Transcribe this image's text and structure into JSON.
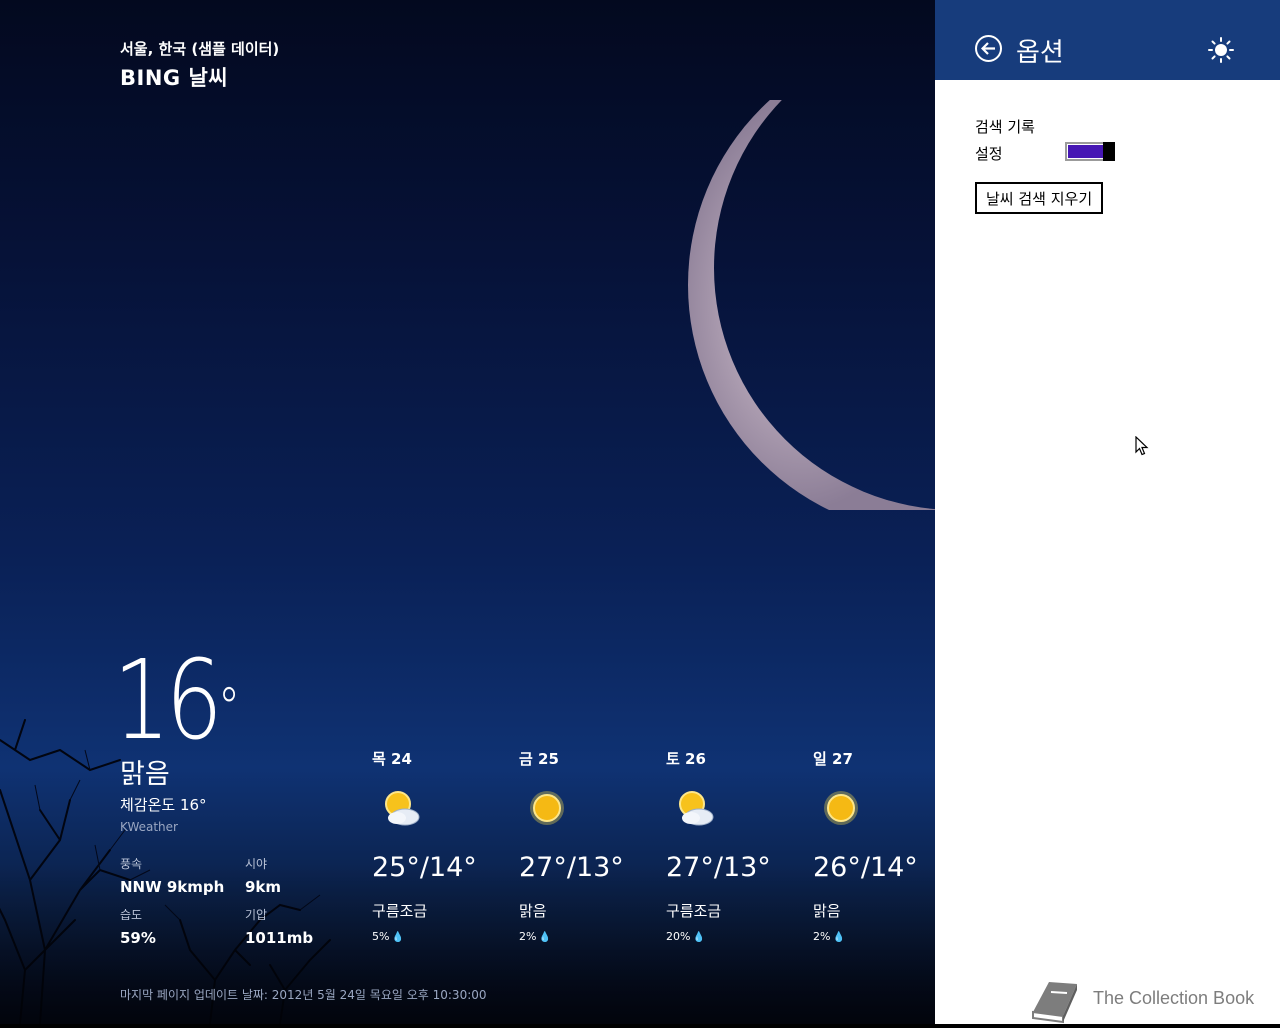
{
  "weather": {
    "location": "서울, 한국 (샘플 데이터)",
    "app_name": "BING 날씨",
    "current": {
      "temperature": "16",
      "degree_symbol": "°",
      "condition": "맑음",
      "feels_like": "체감온도 16°",
      "provider": "KWeather"
    },
    "details": {
      "wind_label": "풍속",
      "wind_value": "NNW 9kmph",
      "visibility_label": "시야",
      "visibility_value": "9km",
      "humidity_label": "습도",
      "humidity_value": "59%",
      "pressure_label": "기압",
      "pressure_value": "1011mb"
    },
    "forecast": [
      {
        "day": "목 24",
        "icon": "partly-cloudy-icon",
        "temp": "25°/14°",
        "condition": "구름조금",
        "precip": "5%"
      },
      {
        "day": "금 25",
        "icon": "sunny-icon",
        "temp": "27°/13°",
        "condition": "맑음",
        "precip": "2%"
      },
      {
        "day": "토 26",
        "icon": "partly-cloudy-icon",
        "temp": "27°/13°",
        "condition": "구름조금",
        "precip": "20%"
      },
      {
        "day": "일 27",
        "icon": "sunny-icon",
        "temp": "26°/14°",
        "condition": "맑음",
        "precip": "2%"
      }
    ],
    "last_updated": "마지막 페이지 업데이트 날짜: 2012년 5월 24일 목요일 오후 10:30:00"
  },
  "flyout": {
    "title": "옵션",
    "back_icon": "back-arrow-icon",
    "brightness_icon": "sun-icon",
    "section_title": "검색 기록",
    "toggle_label": "설정",
    "toggle_on": true,
    "clear_button": "날씨 검색 지우기",
    "header_color": "#173c7c",
    "accent_color": "#4617b4"
  },
  "watermark": {
    "text": "The Collection Book",
    "icon": "book-icon"
  }
}
